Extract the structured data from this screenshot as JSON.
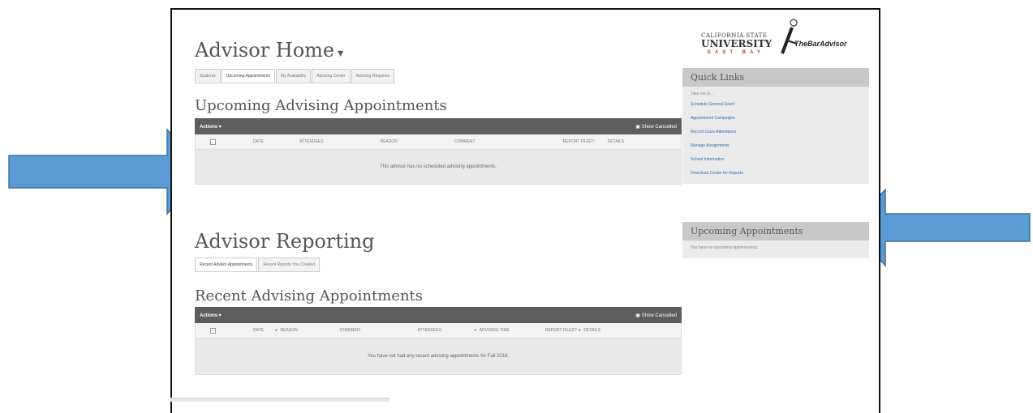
{
  "header": {
    "title": "Advisor Home",
    "caret": "▾"
  },
  "home_tabs": [
    {
      "label": "Students",
      "active": false
    },
    {
      "label": "Upcoming Appointments",
      "active": true
    },
    {
      "label": "My Availability",
      "active": false
    },
    {
      "label": "Advising Center",
      "active": false
    },
    {
      "label": "Advising Requests",
      "active": false
    }
  ],
  "upcoming": {
    "title": "Upcoming Advising Appointments",
    "actions_label": "Actions ▾",
    "show_cancelled": "Show Cancelled",
    "columns": [
      "DATE",
      "ATTENDEES",
      "REASON",
      "COMMENT",
      "REPORT FILED?",
      "DETAILS"
    ],
    "empty_message": "This advisor has no scheduled advising appointments."
  },
  "reporting": {
    "title": "Advisor Reporting",
    "tabs": [
      {
        "label": "Recent Advisor Appointments",
        "active": true
      },
      {
        "label": "Recent Reports You Created",
        "active": false
      }
    ]
  },
  "recent": {
    "title": "Recent Advising Appointments",
    "actions_label": "Actions ▾",
    "show_cancelled": "Show Cancelled",
    "columns": [
      "DATE",
      "REASON",
      "COMMENT",
      "ATTENDEES",
      "ADVISING TIME",
      "REPORT FILED?",
      "DETAILS"
    ],
    "empty_message": "You have not had any recent advising appointments for Fall 2016."
  },
  "logo": {
    "line1": "CALIFORNIA STATE",
    "line2": "UNIVERSITY",
    "line3": "EAST BAY",
    "brand": "TheBarAdvisor"
  },
  "quick_links": {
    "title": "Quick Links",
    "intro": "Take me to...",
    "links": [
      "Schedule General Event",
      "Appointment Campaigns",
      "Record Class Attendance",
      "Manage Assignments",
      "School Information",
      "Download Center for Reports"
    ]
  },
  "upcoming_sidebar": {
    "title": "Upcoming Appointments",
    "message": "You have no upcoming appointments."
  },
  "colors": {
    "arrow": "#5b9bd5",
    "arrow_stroke": "#41719c",
    "table_header": "#5d5d5d",
    "link": "#2a6ebb"
  }
}
